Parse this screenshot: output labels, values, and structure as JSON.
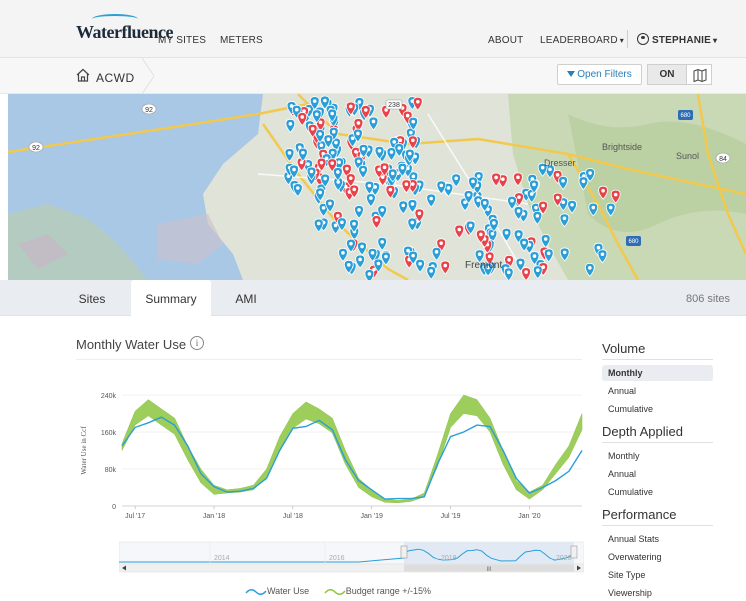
{
  "app": {
    "logo_text": "Waterfluence"
  },
  "topnav": {
    "my_sites": "MY SITES",
    "meters": "METERS",
    "about": "ABOUT",
    "leaderboard": "LEADERBOARD",
    "user": "STEPHANIE",
    "caret": "▾"
  },
  "breadcrumb": {
    "label": "ACWD"
  },
  "toolbar": {
    "open_filters": "Open Filters",
    "on_label": "ON"
  },
  "map": {
    "labels": {
      "dresser": "Dresser",
      "brightside": "Brightside",
      "sunol": "Sunol",
      "fremont": "Fremont",
      "hwy92": "92",
      "hwy238": "238",
      "hwy680": "680",
      "hwy84": "84"
    },
    "colors": {
      "blue_pin": "#2b9ed8",
      "red_pin": "#e8434a"
    }
  },
  "tabs": [
    {
      "label": "Sites",
      "active": false
    },
    {
      "label": "Summary",
      "active": true
    },
    {
      "label": "AMI",
      "active": false
    }
  ],
  "sites_count": "806 sites",
  "chart": {
    "title": "Monthly Water Use",
    "info": "i"
  },
  "sidebar": {
    "volume": {
      "heading": "Volume",
      "items": [
        "Monthly",
        "Annual",
        "Cumulative"
      ],
      "selected": "Monthly"
    },
    "depth": {
      "heading": "Depth Applied",
      "items": [
        "Monthly",
        "Annual",
        "Cumulative"
      ]
    },
    "performance": {
      "heading": "Performance",
      "items": [
        "Annual Stats",
        "Overwatering",
        "Site Type",
        "Viewership"
      ]
    }
  },
  "navigator": {
    "years": [
      "2014",
      "2016",
      "2018",
      "2020"
    ],
    "scroll_thumb": "III"
  },
  "chart_data": {
    "type": "area",
    "title": "",
    "xlabel": "",
    "ylabel": "Water Use in Ccf",
    "ylim": [
      0,
      240000
    ],
    "y_ticks": [
      "0",
      "80k",
      "160k",
      "240k"
    ],
    "x_ticks": [
      "Jul '17",
      "Jan '18",
      "Jul '18",
      "Jan '19",
      "Jul '19",
      "Jan '20"
    ],
    "x": [
      "2017-06",
      "2017-07",
      "2017-08",
      "2017-09",
      "2017-10",
      "2017-11",
      "2017-12",
      "2018-01",
      "2018-02",
      "2018-03",
      "2018-04",
      "2018-05",
      "2018-06",
      "2018-07",
      "2018-08",
      "2018-09",
      "2018-10",
      "2018-11",
      "2018-12",
      "2019-01",
      "2019-02",
      "2019-03",
      "2019-04",
      "2019-05",
      "2019-06",
      "2019-07",
      "2019-08",
      "2019-09",
      "2019-10",
      "2019-11",
      "2019-12",
      "2020-01",
      "2020-02",
      "2020-03",
      "2020-04",
      "2020-05"
    ],
    "series": [
      {
        "name": "Water Use",
        "color": "#2b9ed8",
        "values": [
          130000,
          170000,
          180000,
          192000,
          175000,
          130000,
          70000,
          42000,
          30000,
          32000,
          38000,
          60000,
          120000,
          168000,
          172000,
          185000,
          165000,
          100000,
          55000,
          35000,
          15000,
          16000,
          16000,
          20000,
          90000,
          150000,
          160000,
          175000,
          172000,
          120000,
          60000,
          28000,
          40000,
          55000,
          75000,
          120000
        ]
      },
      {
        "name": "Budget range +/-15%",
        "color": "#8dc63f",
        "upper": [
          135000,
          205000,
          230000,
          210000,
          190000,
          130000,
          80000,
          45000,
          35000,
          38000,
          45000,
          80000,
          150000,
          200000,
          225000,
          210000,
          190000,
          120000,
          60000,
          35000,
          15000,
          12000,
          15000,
          28000,
          110000,
          200000,
          240000,
          230000,
          190000,
          120000,
          55000,
          30000,
          45000,
          90000,
          130000,
          200000
        ],
        "lower": [
          120000,
          175000,
          195000,
          175000,
          155000,
          100000,
          50000,
          25000,
          28000,
          30000,
          35000,
          62000,
          120000,
          168000,
          188000,
          178000,
          158000,
          90000,
          40000,
          20000,
          8000,
          7000,
          10000,
          20000,
          85000,
          170000,
          200000,
          195000,
          160000,
          90000,
          35000,
          15000,
          35000,
          70000,
          105000,
          165000
        ]
      }
    ],
    "legend": {
      "placement": "bottom-center",
      "entries": [
        "Water Use",
        "Budget range +/-15%"
      ]
    },
    "grid": true
  }
}
